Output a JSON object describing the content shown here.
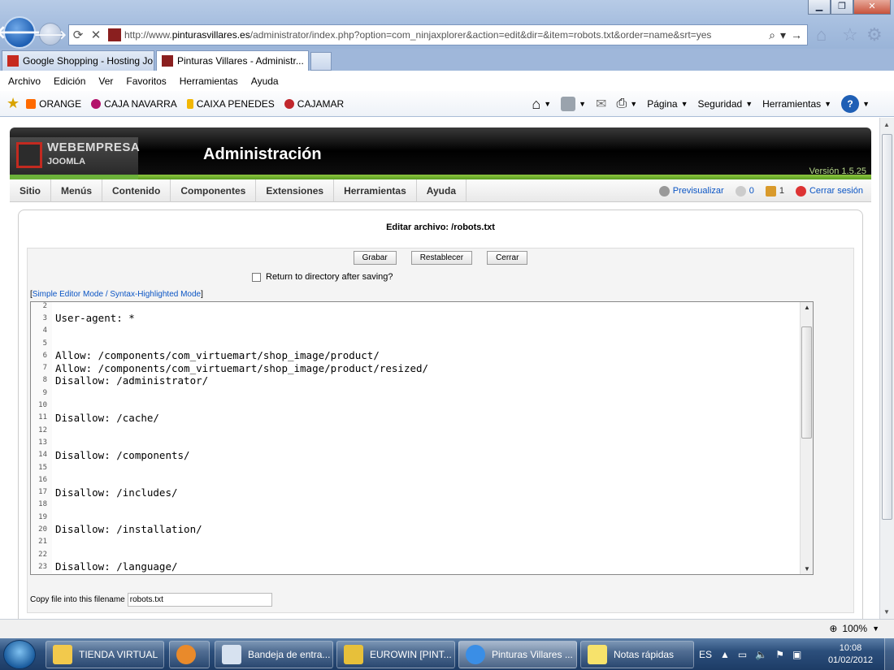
{
  "browser": {
    "url_prefix": "http://www.",
    "url_domain": "pinturasvillares.es",
    "url_path": "/administrator/index.php?option=com_ninjaxplorer&action=edit&dir=&item=robots.txt&order=name&srt=yes",
    "tabs": [
      {
        "label": "Google Shopping - Hosting Jo..."
      },
      {
        "label": "Pinturas Villares - Administr..."
      }
    ],
    "menu": [
      "Archivo",
      "Edición",
      "Ver",
      "Favoritos",
      "Herramientas",
      "Ayuda"
    ],
    "favorites": [
      "ORANGE",
      "CAJA NAVARRA",
      "CAIXA PENEDES",
      "CAJAMAR"
    ],
    "commands": [
      "Página",
      "Seguridad",
      "Herramientas"
    ],
    "zoom": "100%"
  },
  "joomla": {
    "brand": "WEBEMPRESA",
    "brand_sub": "JOOMLA",
    "title": "Administración",
    "version": "Versión 1.5.25",
    "menu": [
      "Sitio",
      "Menús",
      "Contenido",
      "Componentes",
      "Extensiones",
      "Herramientas",
      "Ayuda"
    ],
    "status": {
      "preview": "Previsualizar",
      "messages": "0",
      "users": "1",
      "logout": "Cerrar sesión"
    }
  },
  "editor": {
    "title": "Editar archivo: /robots.txt",
    "buttons": {
      "save": "Grabar",
      "reset": "Restablecer",
      "close": "Cerrar"
    },
    "return_label": "Return to directory after saving?",
    "mode_open": "[",
    "mode_link": "Simple Editor Mode / Syntax-Highlighted Mode",
    "mode_close": "]",
    "lines": [
      {
        "n": "2",
        "code": ""
      },
      {
        "n": "3",
        "code": "User-agent: *"
      },
      {
        "n": "4",
        "code": ""
      },
      {
        "n": "5",
        "code": ""
      },
      {
        "n": "6",
        "code": "Allow: /components/com_virtuemart/shop_image/product/"
      },
      {
        "n": "7",
        "code": "Allow: /components/com_virtuemart/shop_image/product/resized/"
      },
      {
        "n": "8",
        "code": "Disallow: /administrator/"
      },
      {
        "n": "9",
        "code": ""
      },
      {
        "n": "10",
        "code": ""
      },
      {
        "n": "11",
        "code": "Disallow: /cache/"
      },
      {
        "n": "12",
        "code": ""
      },
      {
        "n": "13",
        "code": ""
      },
      {
        "n": "14",
        "code": "Disallow: /components/"
      },
      {
        "n": "15",
        "code": ""
      },
      {
        "n": "16",
        "code": ""
      },
      {
        "n": "17",
        "code": "Disallow: /includes/"
      },
      {
        "n": "18",
        "code": ""
      },
      {
        "n": "19",
        "code": ""
      },
      {
        "n": "20",
        "code": "Disallow: /installation/"
      },
      {
        "n": "21",
        "code": ""
      },
      {
        "n": "22",
        "code": ""
      },
      {
        "n": "23",
        "code": "Disallow: /language/"
      }
    ],
    "copy_label": "Copy file into this filename",
    "copy_value": "robots.txt"
  },
  "taskbar": {
    "items": [
      "TIENDA VIRTUAL",
      "Bandeja de entra...",
      "EUROWIN  [PINT...",
      "Pinturas Villares ...",
      "Notas rápidas"
    ],
    "lang": "ES",
    "time": "10:08",
    "date": "01/02/2012"
  }
}
